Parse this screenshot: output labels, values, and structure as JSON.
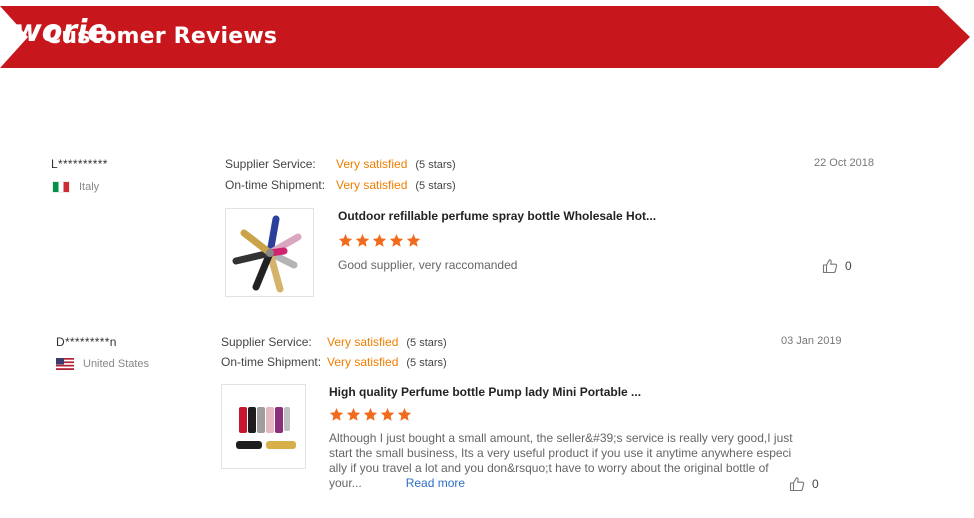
{
  "header": {
    "title": "Customer Reviews",
    "brand": "worie",
    "banner_color": "#c8161d"
  },
  "reviews": [
    {
      "reviewer": "L**********",
      "country": "Italy",
      "supplier_label": "Supplier Service:",
      "supplier_value": "Very satisfied",
      "supplier_stars": "(5 stars)",
      "shipment_label": "On-time Shipment:",
      "shipment_value": "Very satisfied",
      "shipment_stars": "(5 stars)",
      "date": "22 Oct 2018",
      "product_title": "Outdoor refillable perfume spray bottle Wholesale Hot...",
      "rating": 5,
      "text": "Good supplier, very raccomanded",
      "likes": "0"
    },
    {
      "reviewer": "D*********n",
      "country": "United States",
      "supplier_label": "Supplier Service:",
      "supplier_value": "Very satisfied",
      "supplier_stars": "(5 stars)",
      "shipment_label": "On-time Shipment:",
      "shipment_value": "Very satisfied",
      "shipment_stars": "(5 stars)",
      "date": "03 Jan 2019",
      "product_title": "High quality Perfume bottle Pump lady Mini Portable ...",
      "rating": 5,
      "text_lines": [
        "Although I just bought a small amount, the seller&#39;s service is really very good,I just",
        "start the small business, Its a very useful product if you use it anytime anywhere especi",
        "ally if you travel a lot and you don&rsquo;t have to worry about the original bottle of",
        "your..."
      ],
      "read_more": "Read more",
      "likes": "0"
    }
  ],
  "colors": {
    "accent_orange": "#f07d00",
    "star_orange": "#f26b1d",
    "link_blue": "#2b6fc5"
  }
}
